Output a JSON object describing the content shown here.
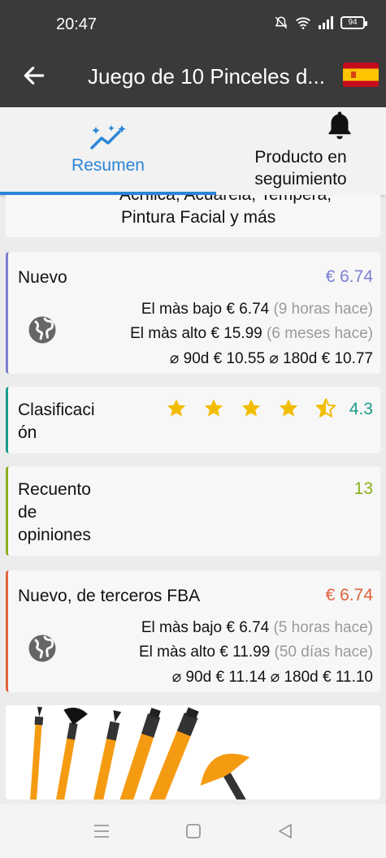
{
  "status_bar": {
    "time": "20:47",
    "battery": "94",
    "icons": [
      "mute-icon",
      "wifi-icon",
      "signal-icon",
      "battery-icon"
    ]
  },
  "app_bar": {
    "title": "Juego de 10 Pinceles d...",
    "back_icon": "arrow-left-icon",
    "flag": "spain-flag"
  },
  "tabs": [
    {
      "label": "Resumen",
      "icon": "chart-sparkle-icon",
      "selected": true,
      "color": "#2a86d8"
    },
    {
      "label_line1": "Producto en",
      "label_line2": "seguimiento",
      "icon": "bell-icon",
      "selected": false
    }
  ],
  "description": {
    "cut_text": "Acrílica, Acuarela, Tempera,",
    "line": "Pintura Facial y más"
  },
  "new_price": {
    "label": "Nuevo",
    "value": "€ 6.74",
    "accent": "#7b7fd0",
    "lowest_label": "El màs bajo",
    "lowest_value": "€ 6.74",
    "lowest_when": "(9 horas hace)",
    "highest_label": "El màs alto",
    "highest_value": "€ 15.99",
    "highest_when": "(6 meses hace)",
    "avg90_label": "⌀ 90d",
    "avg90_value": "€ 10.55",
    "avg180_label": "⌀ 180d",
    "avg180_value": "€ 10.77"
  },
  "rating": {
    "label_line1": "Clasificaci",
    "label_line2": "ón",
    "stars": 4.5,
    "value": "4.3",
    "accent": "#1a9c8a"
  },
  "reviews": {
    "label_line1": "Recuento",
    "label_line2": "de",
    "label_line3": "opiniones",
    "value": "13",
    "accent": "#8aae1a"
  },
  "fba_price": {
    "label": "Nuevo, de terceros FBA",
    "value": "€ 6.74",
    "accent": "#e0623a",
    "lowest_label": "El màs bajo",
    "lowest_value": "€ 6.74",
    "lowest_when": "(5 horas hace)",
    "highest_label": "El màs alto",
    "highest_value": "€ 11.99",
    "highest_when": "(50 días hace)",
    "avg90_label": "⌀ 90d",
    "avg90_value": "€ 11.14",
    "avg180_label": "⌀ 180d",
    "avg180_value": "€ 11.10"
  },
  "nav_bar": {
    "buttons": [
      "menu-icon",
      "home-square-icon",
      "back-triangle-icon"
    ]
  }
}
